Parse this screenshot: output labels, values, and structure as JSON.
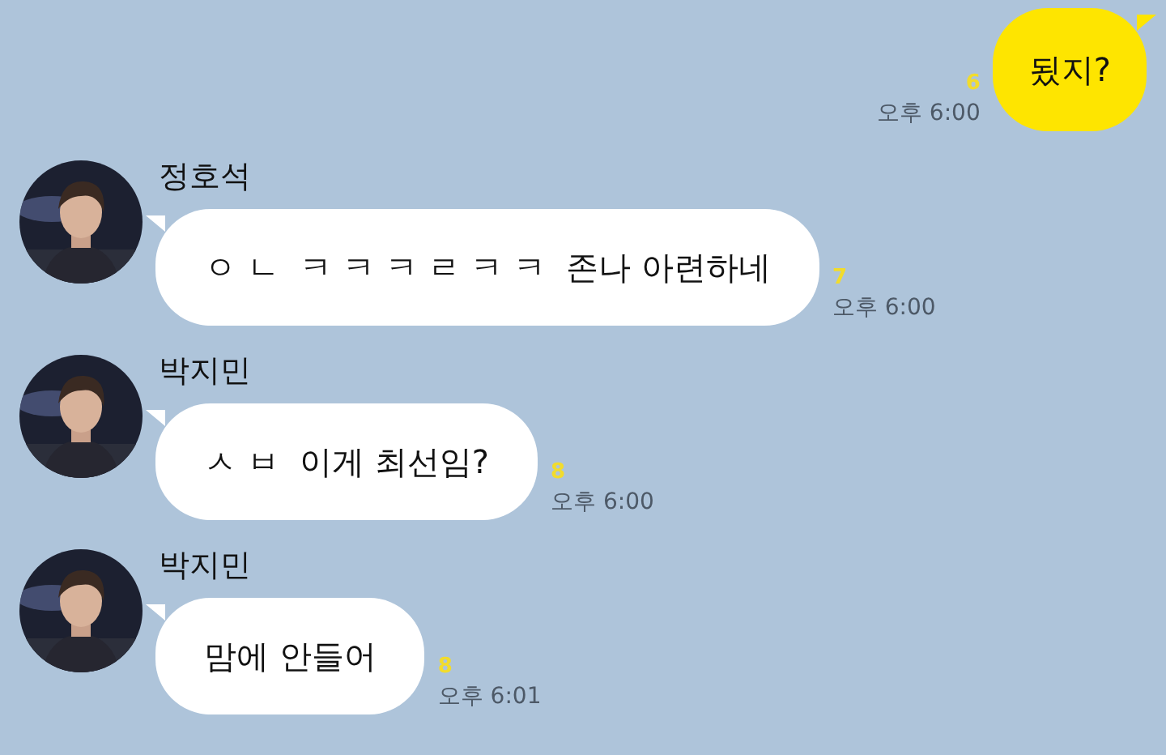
{
  "messages": [
    {
      "kind": "sent",
      "text": "됬지?",
      "unread": "6",
      "time": "오후 6:00"
    },
    {
      "kind": "received",
      "sender": "정호석",
      "text": "ㅇ ㄴ  ㅋ ㅋ ㅋ ㄹ ㅋ ㅋ  존나 아련하네",
      "unread": "7",
      "time": "오후 6:00"
    },
    {
      "kind": "received",
      "sender": "박지민",
      "text": "ㅅ ㅂ  이게 최선임?",
      "unread": "8",
      "time": "오후 6:00"
    },
    {
      "kind": "received",
      "sender": "박지민",
      "text": "맘에 안들어",
      "unread": "8",
      "time": "오후 6:01"
    }
  ]
}
